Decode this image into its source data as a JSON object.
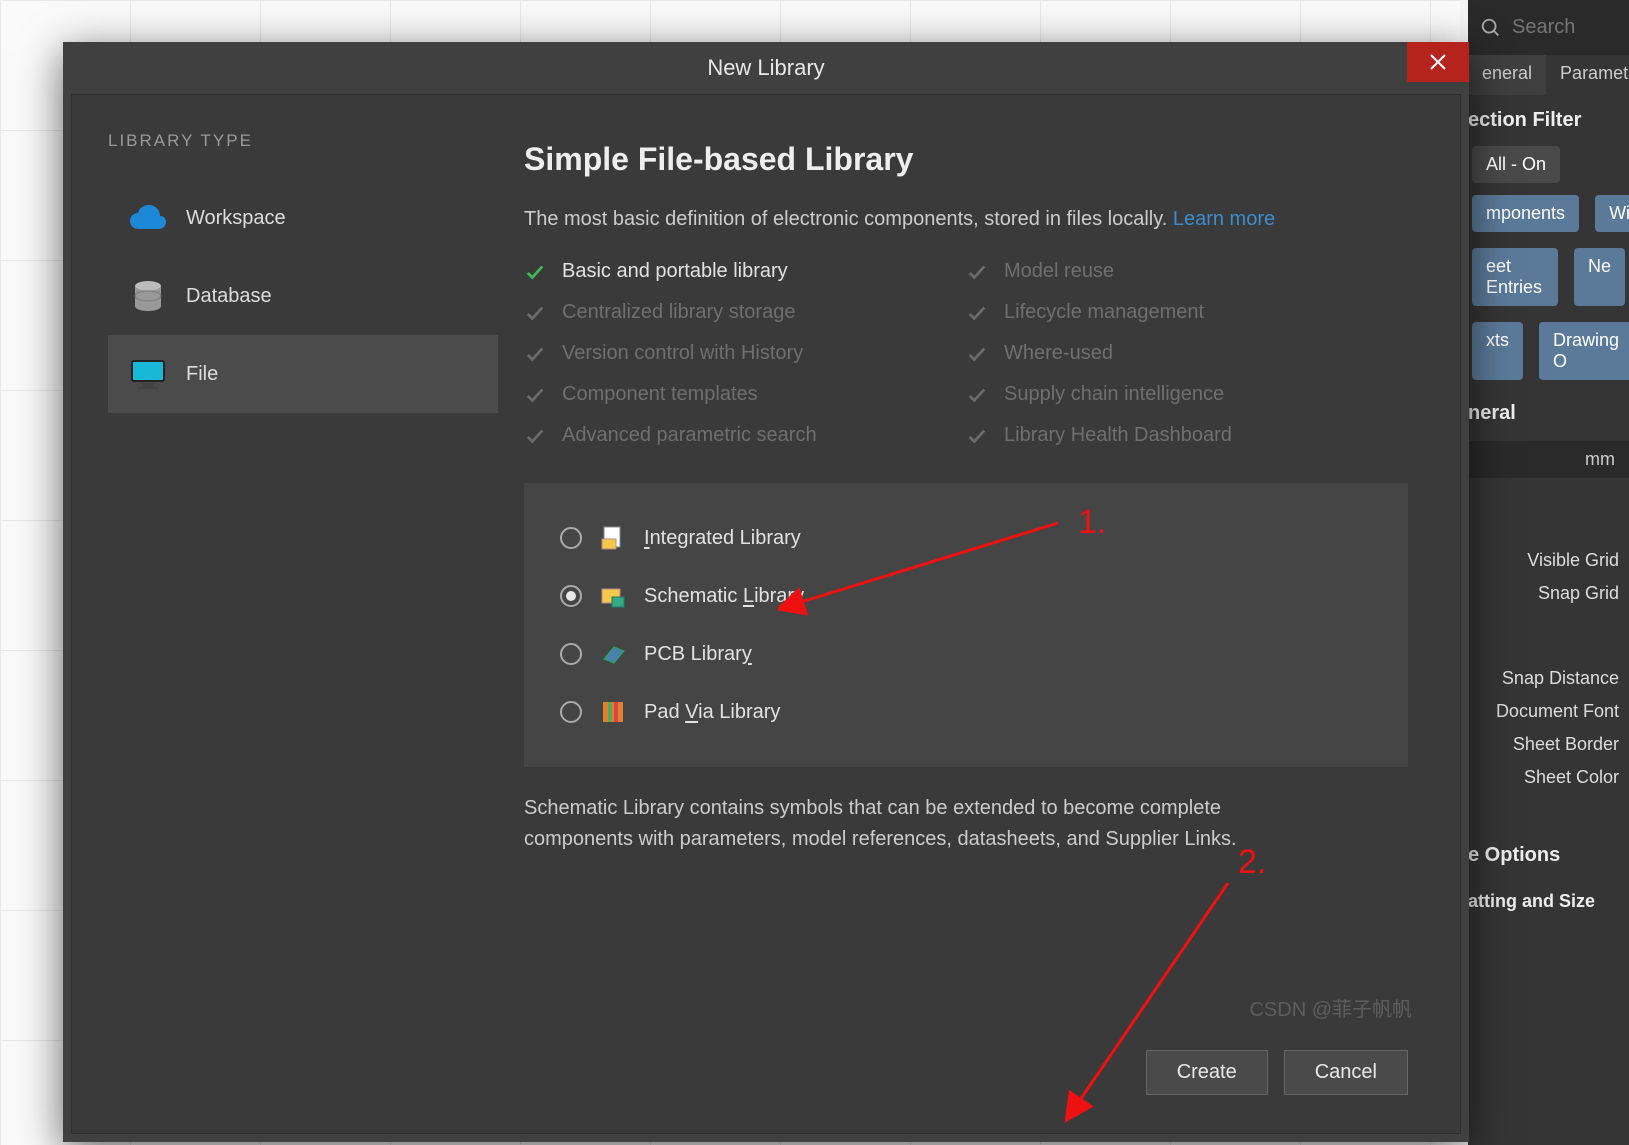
{
  "dialog": {
    "title": "New Library",
    "sidebar_title": "LIBRARY TYPE",
    "types": [
      {
        "label": "Workspace",
        "selected": false,
        "icon": "cloud"
      },
      {
        "label": "Database",
        "selected": false,
        "icon": "database"
      },
      {
        "label": "File",
        "selected": true,
        "icon": "monitor"
      }
    ],
    "content": {
      "heading": "Simple File-based Library",
      "description": "The most basic definition of electronic components, stored in files locally. ",
      "learn_more": "Learn more",
      "features_left": [
        {
          "label": "Basic and portable library",
          "enabled": true
        },
        {
          "label": "Centralized library storage",
          "enabled": false
        },
        {
          "label": "Version control with History",
          "enabled": false
        },
        {
          "label": "Component templates",
          "enabled": false
        },
        {
          "label": "Advanced parametric search",
          "enabled": false
        }
      ],
      "features_right": [
        {
          "label": "Model reuse",
          "enabled": false
        },
        {
          "label": "Lifecycle management",
          "enabled": false
        },
        {
          "label": "Where-used",
          "enabled": false
        },
        {
          "label": "Supply chain intelligence",
          "enabled": false
        },
        {
          "label": "Library Health Dashboard",
          "enabled": false
        }
      ],
      "subtypes": [
        {
          "pre": "",
          "u": "I",
          "post": "ntegrated Library",
          "selected": false,
          "icon": "intlib"
        },
        {
          "pre": "Schematic ",
          "u": "L",
          "post": "ibrary",
          "selected": true,
          "icon": "schlib"
        },
        {
          "pre": "PCB Librar",
          "u": "y",
          "post": "",
          "selected": false,
          "icon": "pcblib"
        },
        {
          "pre": "Pad ",
          "u": "V",
          "post": "ia Library",
          "selected": false,
          "icon": "padlib"
        }
      ],
      "subtype_desc": "Schematic Library contains symbols that can be extended to become complete components with parameters, model references, datasheets, and Supplier Links."
    },
    "buttons": {
      "create": "Create",
      "cancel": "Cancel"
    }
  },
  "right_panel": {
    "search_placeholder": "Search",
    "tabs": [
      "eneral",
      "Paramete"
    ],
    "section_filter": "ection Filter",
    "all_on": "All - On",
    "pills": [
      [
        "mponents",
        "Wi"
      ],
      [
        "eet Entries",
        "Ne"
      ],
      [
        "xts",
        "Drawing O"
      ]
    ],
    "general_head": "neral",
    "unit": "mm",
    "labels": [
      "Visible Grid",
      "Snap Grid",
      "Snap Distance",
      "Document Font",
      "Sheet Border",
      "Sheet Color"
    ],
    "options_head": "e Options",
    "formatting_head": "atting and Size"
  },
  "annotations": {
    "one": "1.",
    "two": "2."
  },
  "watermark": "CSDN @菲子帆帆"
}
